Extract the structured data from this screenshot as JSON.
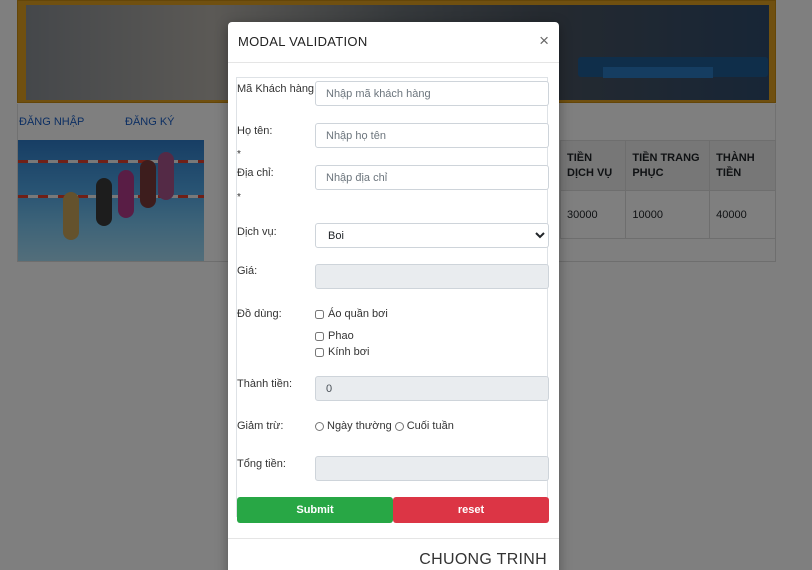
{
  "nav": {
    "login": "ĐĂNG NHẬP",
    "register": "ĐĂNG KÝ"
  },
  "price_table": {
    "headers": [
      "TIỀN DỊCH VỤ",
      "TIỀN TRANG PHỤC",
      "THÀNH TIỀN"
    ],
    "row": [
      "30000",
      "10000",
      "40000"
    ]
  },
  "modal": {
    "title": "MODAL VALIDATION",
    "close": "×",
    "fields": {
      "customer_code": {
        "label": "Mã Khách hàng:",
        "placeholder": "Nhập mã khách hàng",
        "value": ""
      },
      "full_name": {
        "label": "Họ tên:",
        "placeholder": "Nhập họ tên",
        "value": "",
        "required_mark": "*"
      },
      "address": {
        "label": "Địa chỉ:",
        "placeholder": "Nhập địa chỉ",
        "value": "",
        "required_mark": "*"
      },
      "service": {
        "label": "Dịch vụ:",
        "selected": "Boi"
      },
      "price": {
        "label": "Giá:",
        "value": ""
      },
      "equipment": {
        "label": "Đồ dùng:",
        "options": [
          "Áo quần bơi",
          "Phao",
          "Kính bơi"
        ]
      },
      "subtotal": {
        "label": "Thành tiền:",
        "value": "0"
      },
      "discount": {
        "label": "Giảm trừ:",
        "options": [
          "Ngày thường",
          "Cuối tuần"
        ]
      },
      "total": {
        "label": "Tổng tiền:",
        "value": ""
      }
    },
    "buttons": {
      "submit": "Submit",
      "reset": "reset"
    },
    "footer_heading": "CHUONG TRINH"
  },
  "colors": {
    "submit": "#28a745",
    "reset": "#dc3545",
    "link": "#1a5fc6",
    "banner": "#e0a020"
  },
  "icons": {
    "close": "close-icon",
    "select_caret": "chevron-down-icon"
  }
}
